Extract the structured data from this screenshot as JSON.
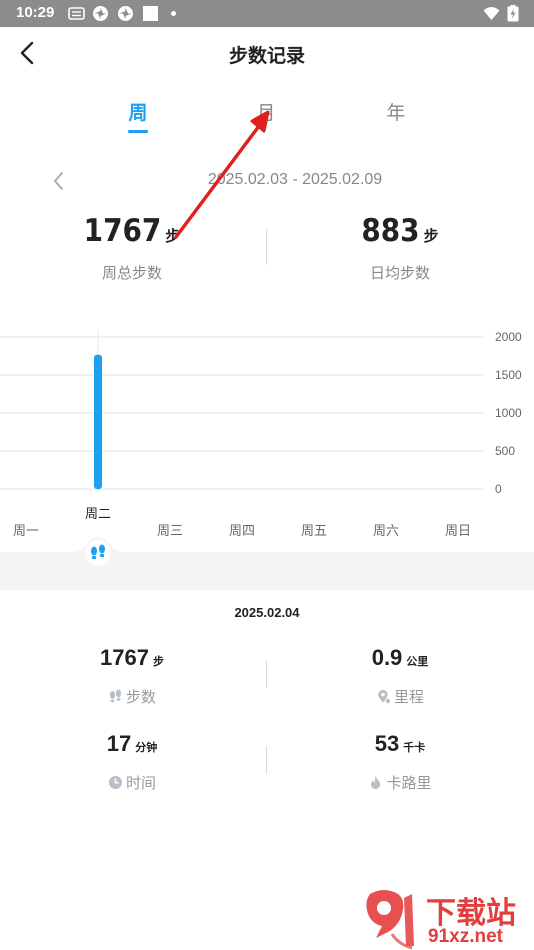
{
  "status_bar": {
    "time": "10:29",
    "icons": [
      "keyboard-icon",
      "pinwheel-icon",
      "pinwheel-icon",
      "square-icon",
      "dot-icon",
      "wifi-icon",
      "battery-charging-icon"
    ]
  },
  "header": {
    "title": "步数记录",
    "back_icon": "chevron-left-icon"
  },
  "tabs": [
    {
      "label": "周",
      "active": true
    },
    {
      "label": "月",
      "active": false
    },
    {
      "label": "年",
      "active": false
    }
  ],
  "date_range": {
    "label": "2025.02.03 - 2025.02.09"
  },
  "summary": {
    "total": {
      "value": "1767",
      "unit": "步",
      "caption": "周总步数"
    },
    "average": {
      "value": "883",
      "unit": "步",
      "caption": "日均步数"
    }
  },
  "chart_data": {
    "type": "bar",
    "categories": [
      "周一",
      "周二",
      "周三",
      "周四",
      "周五",
      "周六",
      "周日"
    ],
    "values": [
      0,
      1767,
      0,
      0,
      0,
      0,
      0
    ],
    "y_ticks": [
      "2000",
      "1500",
      "1000",
      "500",
      "0"
    ],
    "ylim": [
      0,
      2000
    ],
    "selected_index": 1,
    "bar_color": "#1ba1f0",
    "grid": true
  },
  "detail": {
    "date": "2025.02.04",
    "metrics": [
      {
        "value": "1767",
        "unit": "步",
        "caption": "步数",
        "icon": "footprints-icon"
      },
      {
        "value": "0.9",
        "unit": "公里",
        "caption": "里程",
        "icon": "location-pin-icon"
      },
      {
        "value": "17",
        "unit": "分钟",
        "caption": "时间",
        "icon": "clock-icon"
      },
      {
        "value": "53",
        "unit": "千卡",
        "caption": "卡路里",
        "icon": "flame-icon"
      }
    ]
  },
  "watermark": {
    "title": "下载站",
    "url": "91xz.net",
    "color": "#e43d3d"
  },
  "colors": {
    "accent": "#1ba1f0",
    "annotation_arrow": "#e02020"
  }
}
